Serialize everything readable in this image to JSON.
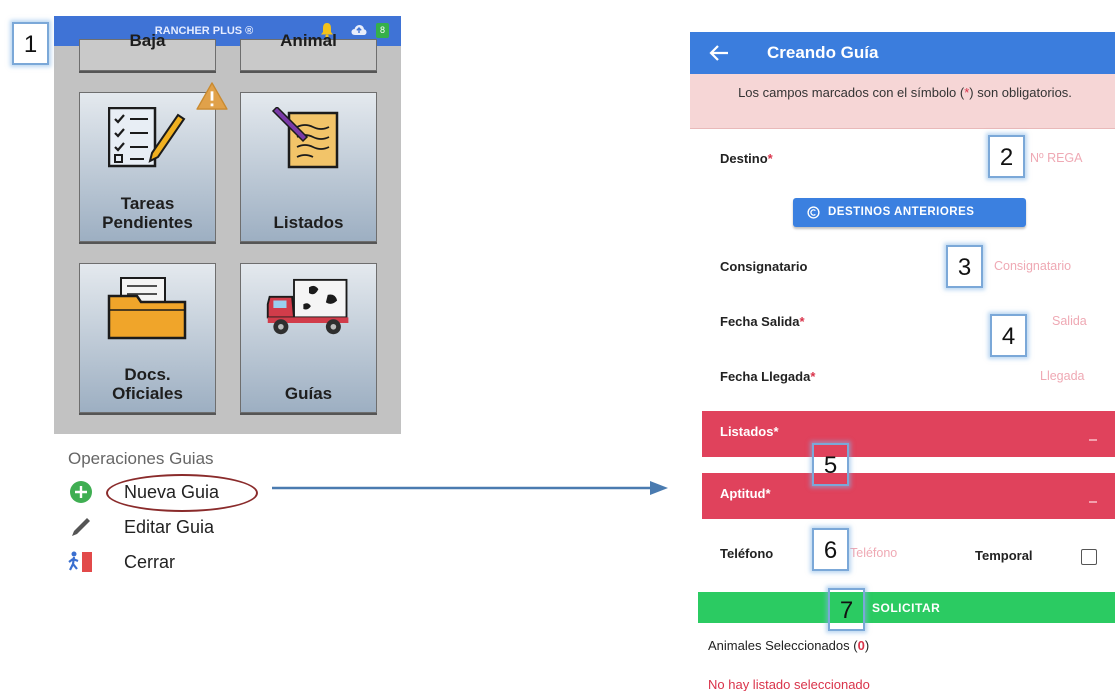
{
  "left_app": {
    "title": "RANCHER PLUS ®",
    "battery": "8",
    "tiles": {
      "baja": "Baja",
      "animal": "Animal",
      "tareas": [
        "Tareas",
        "Pendientes"
      ],
      "listados": "Listados",
      "docs": [
        "Docs.",
        "Oficiales"
      ],
      "guias": "Guías"
    }
  },
  "menu": {
    "heading": "Operaciones Guias",
    "items": [
      "Nueva Guia",
      "Editar Guia",
      "Cerrar"
    ]
  },
  "form": {
    "header_title": "Creando Guía",
    "notice": {
      "before": "Los campos marcados con el símbolo (",
      "star": "*",
      "after": ") son obligatorios."
    },
    "required_mark": "*",
    "destino": {
      "label": "Destino",
      "placeholder": "Nº REGA"
    },
    "destinos_button": "DESTINOS ANTERIORES",
    "consignatario": {
      "label": "Consignatario",
      "placeholder": "Consignatario"
    },
    "fecha_salida": {
      "label": "Fecha Salida",
      "placeholder": "Salida"
    },
    "fecha_llegada": {
      "label": "Fecha Llegada",
      "placeholder": "Llegada"
    },
    "listados": {
      "label": "Listados"
    },
    "aptitud": {
      "label": "Aptitud"
    },
    "telefono": {
      "label": "Teléfono",
      "placeholder": "Teléfono"
    },
    "temporal": {
      "label": "Temporal",
      "checked": false
    },
    "solicitar_button": "SOLICITAR",
    "animales": {
      "label": "Animales Seleccionados (",
      "count": "0",
      "close": ")"
    },
    "no_listado": "No hay listado seleccionado"
  },
  "callouts": [
    "1",
    "2",
    "3",
    "4",
    "5",
    "6",
    "7"
  ],
  "colors": {
    "left_topbar": "#3f73d6",
    "header_blue": "#3b7ddd",
    "required_red": "#d9334a",
    "band_red": "#e0425c",
    "solicitar_green": "#2bcb62",
    "callout_border": "#7ba8d8",
    "ellipse": "#8a2b2b",
    "arrow": "#4a7bb0"
  }
}
